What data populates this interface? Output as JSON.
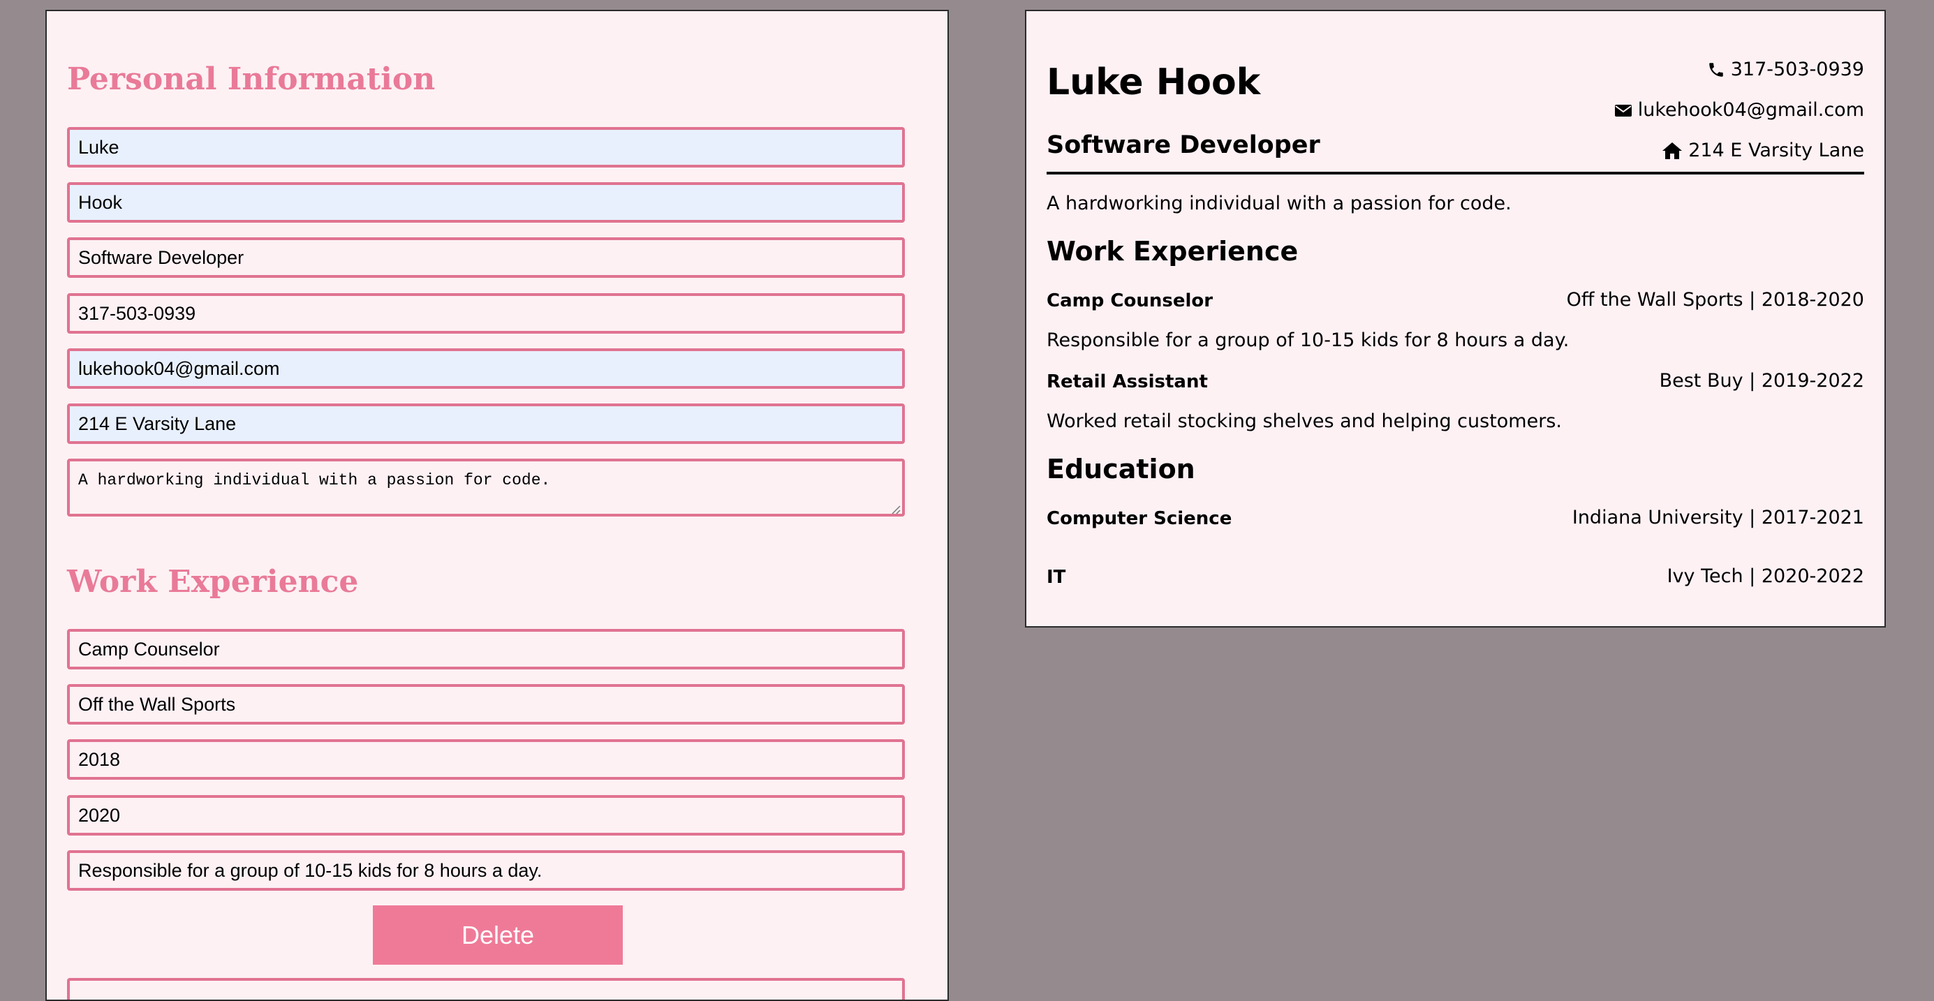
{
  "editor": {
    "personal_heading": "Personal Information",
    "work_heading": "Work Experience",
    "personal": {
      "first_name": "Luke",
      "last_name": "Hook",
      "title": "Software Developer",
      "phone": "317-503-0939",
      "email": "lukehook04@gmail.com",
      "address": "214 E Varsity Lane",
      "summary": "A hardworking individual with a passion for code."
    },
    "work": {
      "position": "Camp Counselor",
      "company": "Off the Wall Sports",
      "start_year": "2018",
      "end_year": "2020",
      "description": "Responsible for a group of 10-15 kids for 8 hours a day."
    },
    "delete_label": "Delete"
  },
  "preview": {
    "name": "Luke Hook",
    "job_title": "Software Developer",
    "phone": "317-503-0939",
    "email": "lukehook04@gmail.com",
    "address": "214 E Varsity Lane",
    "summary": "A hardworking individual with a passion for code.",
    "work_heading": "Work Experience",
    "work": [
      {
        "title": "Camp Counselor",
        "meta": "Off the Wall Sports | 2018-2020",
        "description": "Responsible for a group of 10-15 kids for 8 hours a day."
      },
      {
        "title": "Retail Assistant",
        "meta": "Best Buy | 2019-2022",
        "description": "Worked retail stocking shelves and helping customers."
      }
    ],
    "education_heading": "Education",
    "education": [
      {
        "title": "Computer Science",
        "meta": "Indiana University | 2017-2021"
      },
      {
        "title": "IT",
        "meta": "Ivy Tech | 2020-2022"
      }
    ]
  },
  "icons": {
    "phone": "phone-icon",
    "email": "envelope-icon",
    "address": "home-icon"
  },
  "colors": {
    "background": "#958b8f",
    "panel": "#fdf1f4",
    "accent": "#e97a98",
    "input_border": "#e07391",
    "autofill": "#e8f0fe",
    "button": "#ef7a98"
  }
}
